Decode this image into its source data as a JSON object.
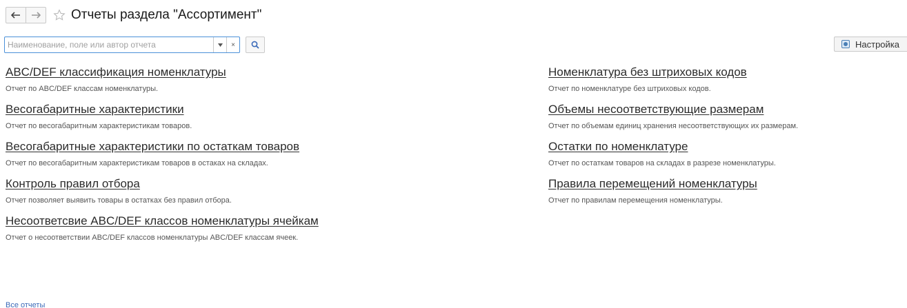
{
  "header": {
    "title": "Отчеты раздела \"Ассортимент\"",
    "back_icon": "arrow-left-icon",
    "forward_icon": "arrow-right-icon",
    "favorite_icon": "star-icon"
  },
  "search": {
    "placeholder": "Наименование, поле или автор отчета",
    "value": "",
    "dropdown_icon": "chevron-down-icon",
    "clear_label": "×",
    "find_icon": "search-icon"
  },
  "settings": {
    "label": "Настройка",
    "icon": "settings-icon"
  },
  "reports_left": [
    {
      "title": "ABC/DEF классификация номенклатуры",
      "description": "Отчет по ABC/DEF классам номенклатуры."
    },
    {
      "title": "Весогабаритные характеристики",
      "description": "Отчет по весогабаритным характеристикам товаров."
    },
    {
      "title": "Весогабаритные характеристики по остаткам товаров",
      "description": "Отчет по весогабаритным характеристикам товаров в остаках на складах."
    },
    {
      "title": "Контроль правил отбора",
      "description": "Отчет позволяет выявить товары в остатках без правил отбора."
    },
    {
      "title": "Несоответсвие ABC/DEF классов номенклатуры ячейкам",
      "description": "Отчет о несоответствии ABC/DEF классов номенклатуры ABC/DEF классам ячеек."
    }
  ],
  "reports_right": [
    {
      "title": "Номенклатура без штриховых кодов",
      "description": "Отчет по номенклатуре без штриховых кодов."
    },
    {
      "title": "Объемы несоответствующие размерам",
      "description": "Отчет по объемам единиц хранения несоответствующих их размерам."
    },
    {
      "title": "Остатки по номенклатуре",
      "description": "Отчет по остаткам товаров на складах в разрезе номенклатуры."
    },
    {
      "title": "Правила перемещений номенклатуры",
      "description": "Отчет по правилам перемещения номенклатуры."
    }
  ],
  "footer": {
    "all_reports_label": "Все отчеты"
  },
  "colors": {
    "accent": "#4a90d9",
    "link": "#3b6ab8"
  }
}
